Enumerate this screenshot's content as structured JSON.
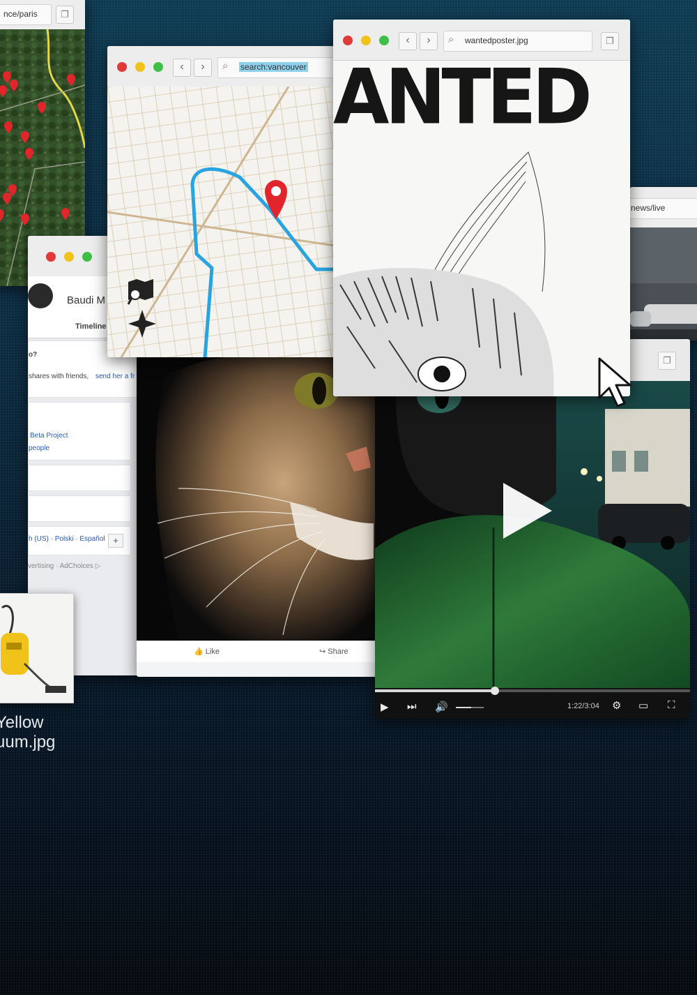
{
  "background": {
    "colors": [
      "#0d3a52",
      "#05101c"
    ]
  },
  "paris_window": {
    "address": "nce/paris",
    "pin_icon": "map-pin-icon"
  },
  "vancouver_window": {
    "address": "search:vancouver",
    "tools": [
      "map-search-icon",
      "compass-icon"
    ],
    "route_color": "#2aa4e0",
    "pin_color": "#e0262a"
  },
  "poster_window": {
    "address": "wantedposter.jpg",
    "headline": "ANTED"
  },
  "news_window": {
    "address": "news/live"
  },
  "facebook_window": {
    "profile_name": "Baudi M",
    "tab": "Timeline",
    "intro_prefix": "o?",
    "share_text": "shares with friends,",
    "share_link": "send her a fr",
    "project": "Beta Project",
    "people": "people",
    "languages": "h (US) · Polski · Español",
    "plus": "+",
    "footer": "vertising · AdChoices ▷",
    "like_label": "Like",
    "share_label": "Share"
  },
  "video_player": {
    "progress": 0.38,
    "time": "1:22/3:04",
    "volume_level": 0.55
  },
  "file_icon": {
    "caption_line1": "Yellow",
    "caption_line2": "uum.jpg"
  }
}
